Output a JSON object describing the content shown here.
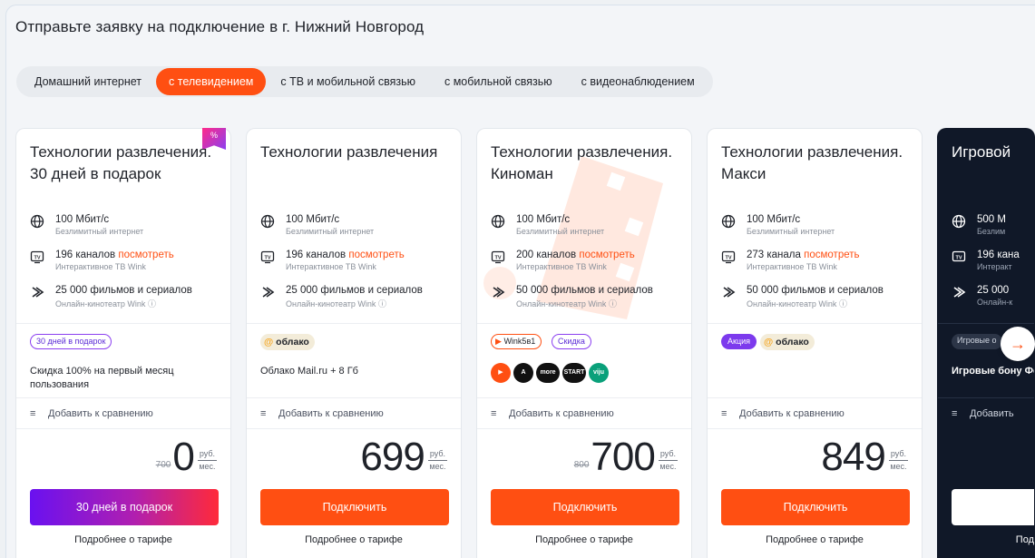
{
  "header": {
    "title": "Отправьте заявку на подключение в г. Нижний Новгород"
  },
  "tabs": [
    {
      "label": "Домашний интернет",
      "active": false
    },
    {
      "label": "с телевидением",
      "active": true
    },
    {
      "label": "с ТВ и мобильной связью",
      "active": false
    },
    {
      "label": "с мобильной связью",
      "active": false
    },
    {
      "label": "с видеонаблюдением",
      "active": false
    }
  ],
  "colors": {
    "accent": "#ff4f12",
    "promo": "#7c3aed",
    "dark_card": "#101828"
  },
  "cards": [
    {
      "name": "Технологии развлечения. 30 дней в подарок",
      "corner_badge": "%",
      "internet": {
        "speed": "100 Мбит/с",
        "desc": "Безлимитный интернет"
      },
      "tv": {
        "count": "196 каналов",
        "link": "посмотреть",
        "desc": "Интерактивное ТВ Wink"
      },
      "movies": {
        "count": "25 000 фильмов и сериалов",
        "desc": "Онлайн-кинотеатр Wink"
      },
      "badges": [
        "30 дней в подарок"
      ],
      "promo_text": "Скидка 100% на первый месяц пользования",
      "compare": "Добавить к сравнению",
      "old_price": "700",
      "price": "0",
      "unit_rub": "руб.",
      "unit_mes": "мес.",
      "cta": "30 дней в подарок",
      "more": "Подробнее о тарифе"
    },
    {
      "name": "Технологии развлечения",
      "internet": {
        "speed": "100 Мбит/с",
        "desc": "Безлимитный интернет"
      },
      "tv": {
        "count": "196 каналов",
        "link": "посмотреть",
        "desc": "Интерактивное ТВ Wink"
      },
      "movies": {
        "count": "25 000 фильмов и сериалов",
        "desc": "Онлайн-кинотеатр Wink"
      },
      "badges": [
        "облако"
      ],
      "promo_text": "Облако Mail.ru + 8 Гб",
      "compare": "Добавить к сравнению",
      "price": "699",
      "unit_rub": "руб.",
      "unit_mes": "мес.",
      "cta": "Подключить",
      "more": "Подробнее о тарифе"
    },
    {
      "name": "Технологии развлечения. Киноман",
      "internet": {
        "speed": "100 Мбит/с",
        "desc": "Безлимитный интернет"
      },
      "tv": {
        "count": "200 каналов",
        "link": "посмотреть",
        "desc": "Интерактивное ТВ Wink"
      },
      "movies": {
        "count": "50 000 фильмов и сериалов",
        "desc": "Онлайн-кинотеатр Wink"
      },
      "badges": [
        "Wink5в1",
        "Скидка"
      ],
      "logos": [
        "▶",
        "A",
        "more",
        "START",
        "viju"
      ],
      "compare": "Добавить к сравнению",
      "old_price": "800",
      "price": "700",
      "unit_rub": "руб.",
      "unit_mes": "мес.",
      "cta": "Подключить",
      "more": "Подробнее о тарифе"
    },
    {
      "name": "Технологии развлечения. Макси",
      "internet": {
        "speed": "100 Мбит/с",
        "desc": "Безлимитный интернет"
      },
      "tv": {
        "count": "273 канала",
        "link": "посмотреть",
        "desc": "Интерактивное ТВ Wink"
      },
      "movies": {
        "count": "50 000 фильмов и сериалов",
        "desc": "Онлайн-кинотеатр Wink"
      },
      "badges": [
        "Акция",
        "облако"
      ],
      "compare": "Добавить к сравнению",
      "price": "849",
      "unit_rub": "руб.",
      "unit_mes": "мес.",
      "cta": "Подключить",
      "more": "Подробнее о тарифе"
    },
    {
      "name": "Игровой",
      "internet": {
        "speed": "500 М",
        "desc": "Безлим"
      },
      "tv": {
        "count": "196 кана",
        "desc": "Интеракт"
      },
      "movies": {
        "count": "25 000",
        "desc": "Онлайн-к"
      },
      "badges": [
        "Игровые о"
      ],
      "promo_text": "Игровые бону Фогейм",
      "compare": "Добавить",
      "more": "Под"
    }
  ],
  "icons": {
    "internet": "globe-icon",
    "tv": "tv-icon",
    "movies": "film-icon",
    "compare": "compare-icon",
    "next": "arrow-right-icon"
  }
}
